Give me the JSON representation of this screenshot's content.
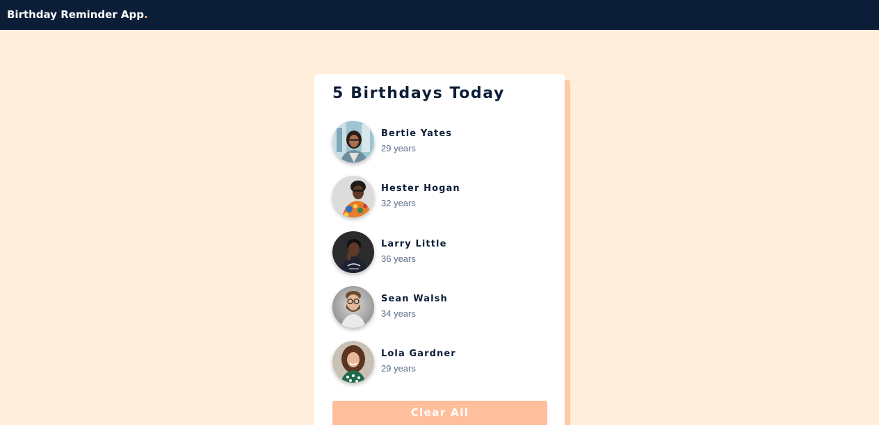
{
  "app": {
    "brand": "Birthday Reminder App",
    "brand_dot": "."
  },
  "card": {
    "count": "5",
    "title_suffix": "Birthdays Today",
    "people": [
      {
        "name": "Bertie Yates",
        "age": "29 years"
      },
      {
        "name": "Hester Hogan",
        "age": "32 years"
      },
      {
        "name": "Larry Little",
        "age": "36 years"
      },
      {
        "name": "Sean Walsh",
        "age": "34 years"
      },
      {
        "name": "Lola Gardner",
        "age": "29 years"
      }
    ],
    "clear_label": "Clear All"
  },
  "colors": {
    "navbar": "#0c1d37",
    "background": "#ffeedc",
    "accent": "#ffbe9c",
    "heading": "#0c1d37",
    "subtext": "#5a6d8c"
  },
  "icons": {
    "avatars": [
      "avatar-photo",
      "avatar-photo",
      "avatar-photo",
      "avatar-photo",
      "avatar-photo"
    ]
  }
}
